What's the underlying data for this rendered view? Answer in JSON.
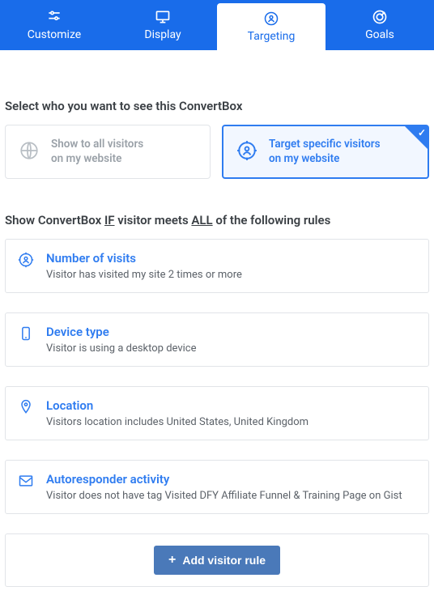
{
  "nav": {
    "items": [
      {
        "id": "customize",
        "label": "Customize"
      },
      {
        "id": "display",
        "label": "Display"
      },
      {
        "id": "targeting",
        "label": "Targeting"
      },
      {
        "id": "goals",
        "label": "Goals"
      }
    ],
    "active_index": 2
  },
  "heading": "Select who you want to see this ConvertBox",
  "options": {
    "all": {
      "line1": "Show to all visitors",
      "line2": "on my website",
      "selected": false
    },
    "target": {
      "line1": "Target specific visitors",
      "line2": "on my website",
      "selected": true
    }
  },
  "rules_heading": {
    "prefix": "Show ConvertBox ",
    "if_word": "IF",
    "mid": " visitor meets ",
    "all_word": "ALL",
    "suffix": " of the following rules"
  },
  "rules": [
    {
      "icon": "visits",
      "title": "Number of visits",
      "desc": "Visitor has visited my site 2 times or more"
    },
    {
      "icon": "device",
      "title": "Device type",
      "desc": "Visitor is using a desktop device"
    },
    {
      "icon": "location",
      "title": "Location",
      "desc": "Visitors location includes United States, United Kingdom"
    },
    {
      "icon": "autoresponder",
      "title": "Autoresponder activity",
      "desc": "Visitor does not have tag Visited DFY Affiliate Funnel & Training Page on Gist"
    }
  ],
  "add_rule_label": "Add visitor rule"
}
